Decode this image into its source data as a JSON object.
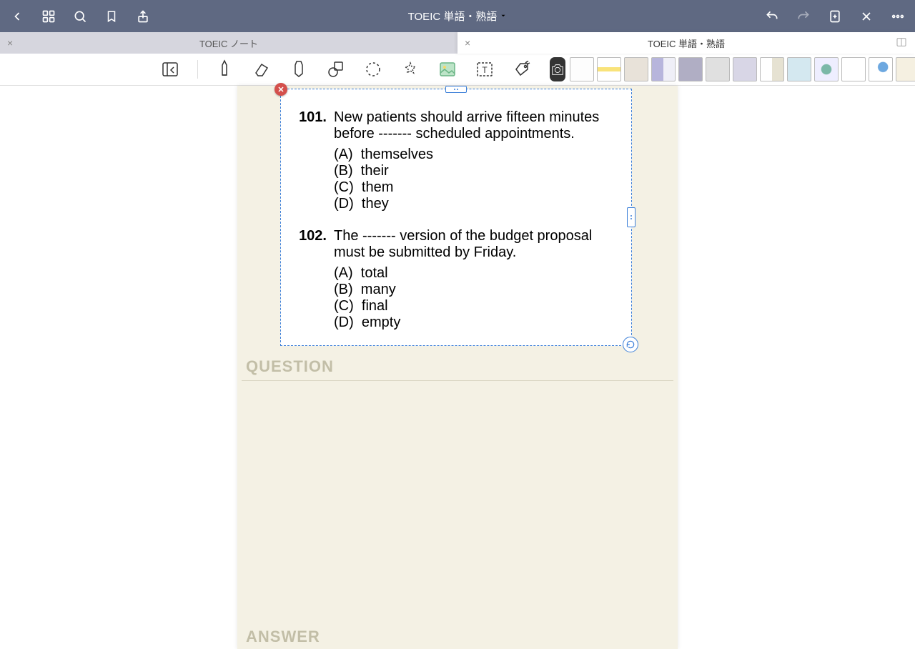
{
  "header": {
    "title": "TOEIC 単語・熟語"
  },
  "tabs": [
    {
      "label": "TOEIC ノート",
      "active": false
    },
    {
      "label": "TOEIC 単語・熟語",
      "active": true
    }
  ],
  "page_labels": {
    "question": "QUESTION",
    "answer": "ANSWER"
  },
  "questions": [
    {
      "number": "101.",
      "text": "New patients should arrive fifteen minutes before ------- scheduled appointments.",
      "options": [
        {
          "letter": "(A)",
          "text": "themselves"
        },
        {
          "letter": "(B)",
          "text": "their"
        },
        {
          "letter": "(C)",
          "text": "them"
        },
        {
          "letter": "(D)",
          "text": "they"
        }
      ]
    },
    {
      "number": "102.",
      "text": "The ------- version of the budget proposal must be submitted by Friday.",
      "options": [
        {
          "letter": "(A)",
          "text": "total"
        },
        {
          "letter": "(B)",
          "text": "many"
        },
        {
          "letter": "(C)",
          "text": "final"
        },
        {
          "letter": "(D)",
          "text": "empty"
        }
      ]
    }
  ]
}
